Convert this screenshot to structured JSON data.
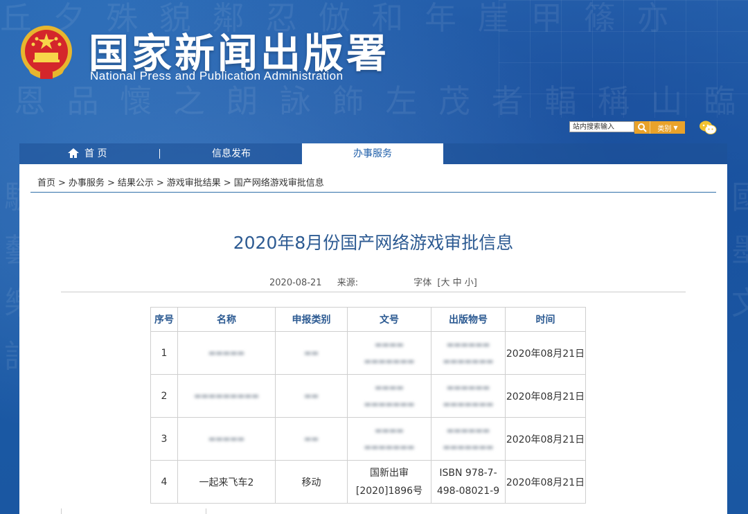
{
  "header": {
    "title_cn": "国家新闻出版署",
    "title_en": "National Press and Publication Administration"
  },
  "search": {
    "placeholder": "站内搜索输入",
    "category_label": "类别"
  },
  "nav": {
    "home": "首 页",
    "news": "信息发布",
    "services": "办事服务"
  },
  "breadcrumb": [
    "首页",
    "办事服务",
    "结果公示",
    "游戏审批结果",
    "国产网络游戏审批信息"
  ],
  "breadcrumb_sep": ">",
  "article": {
    "title": "2020年8月份国产网络游戏审批信息",
    "date": "2020-08-21",
    "source_label": "来源:",
    "font_label": "字体",
    "font_options": "[大 中 小]"
  },
  "table": {
    "headers": [
      "序号",
      "名称",
      "申报类别",
      "文号",
      "出版物号",
      "时间"
    ],
    "rows": [
      {
        "no": "1",
        "name": "",
        "category": "",
        "doc_line1": "",
        "doc_line2": "",
        "isbn_line1": "",
        "isbn_line2": "",
        "time": "2020年08月21日",
        "obscured": true
      },
      {
        "no": "2",
        "name": "",
        "category": "",
        "doc_line1": "",
        "doc_line2": "",
        "isbn_line1": "",
        "isbn_line2": "",
        "time": "2020年08月21日",
        "obscured": true
      },
      {
        "no": "3",
        "name": "",
        "category": "",
        "doc_line1": "",
        "doc_line2": "",
        "isbn_line1": "",
        "isbn_line2": "",
        "time": "2020年08月21日",
        "obscured": true
      },
      {
        "no": "4",
        "name": "一起来飞车2",
        "category": "移动",
        "doc_line1": "国新出审",
        "doc_line2": "[2020]1896号",
        "isbn_line1": "ISBN 978-7-",
        "isbn_line2": "498-08021-9",
        "time": "2020年08月21日",
        "obscured": false
      }
    ]
  },
  "colors": {
    "brand_blue": "#1e5ea9",
    "accent_orange": "#e9a22a",
    "title_blue": "#2c5a92"
  }
}
